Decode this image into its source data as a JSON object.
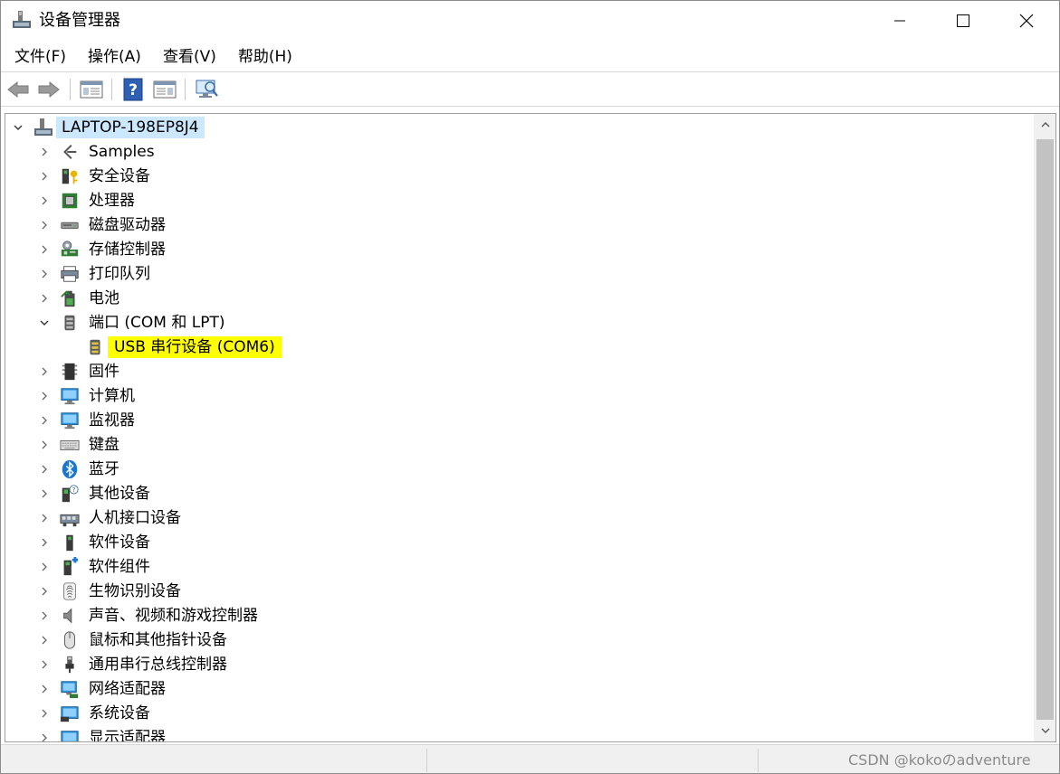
{
  "window": {
    "title": "设备管理器"
  },
  "menu": [
    "文件(F)",
    "操作(A)",
    "查看(V)",
    "帮助(H)"
  ],
  "toolbar": {
    "icons": [
      "back-arrow-icon",
      "forward-arrow-icon",
      "properties-panel-icon",
      "help-icon",
      "update-driver-icon",
      "scan-hardware-icon"
    ]
  },
  "tree": {
    "root": "LAPTOP-198EP8J4",
    "items": [
      {
        "label": "Samples",
        "icon": "samples-icon",
        "expanded": false
      },
      {
        "label": "安全设备",
        "icon": "security-device-icon",
        "expanded": false
      },
      {
        "label": "处理器",
        "icon": "processor-icon",
        "expanded": false
      },
      {
        "label": "磁盘驱动器",
        "icon": "disk-drive-icon",
        "expanded": false
      },
      {
        "label": "存储控制器",
        "icon": "storage-controller-icon",
        "expanded": false
      },
      {
        "label": "打印队列",
        "icon": "print-queue-icon",
        "expanded": false
      },
      {
        "label": "电池",
        "icon": "battery-icon",
        "expanded": false
      },
      {
        "label": "端口 (COM 和 LPT)",
        "icon": "port-icon",
        "expanded": true
      },
      {
        "label": "USB 串行设备 (COM6)",
        "icon": "usb-serial-icon",
        "child": true,
        "highlighted": true
      },
      {
        "label": "固件",
        "icon": "firmware-icon",
        "expanded": false
      },
      {
        "label": "计算机",
        "icon": "computer-icon",
        "expanded": false
      },
      {
        "label": "监视器",
        "icon": "monitor-icon",
        "expanded": false
      },
      {
        "label": "键盘",
        "icon": "keyboard-icon",
        "expanded": false
      },
      {
        "label": "蓝牙",
        "icon": "bluetooth-icon",
        "expanded": false
      },
      {
        "label": "其他设备",
        "icon": "other-devices-icon",
        "expanded": false
      },
      {
        "label": "人机接口设备",
        "icon": "hid-icon",
        "expanded": false
      },
      {
        "label": "软件设备",
        "icon": "software-device-icon",
        "expanded": false
      },
      {
        "label": "软件组件",
        "icon": "software-component-icon",
        "expanded": false
      },
      {
        "label": "生物识别设备",
        "icon": "biometric-icon",
        "expanded": false
      },
      {
        "label": "声音、视频和游戏控制器",
        "icon": "audio-icon",
        "expanded": false
      },
      {
        "label": "鼠标和其他指针设备",
        "icon": "mouse-icon",
        "expanded": false
      },
      {
        "label": "通用串行总线控制器",
        "icon": "usb-controller-icon",
        "expanded": false
      },
      {
        "label": "网络适配器",
        "icon": "network-adapter-icon",
        "expanded": false
      },
      {
        "label": "系统设备",
        "icon": "system-device-icon",
        "expanded": false
      },
      {
        "label": "显示适配器",
        "icon": "display-adapter-icon",
        "expanded": false
      }
    ]
  },
  "status": {
    "watermark": "CSDN @kokoのadventure"
  },
  "colors": {
    "selection": "#cce8ff",
    "highlight": "#ffff00"
  }
}
